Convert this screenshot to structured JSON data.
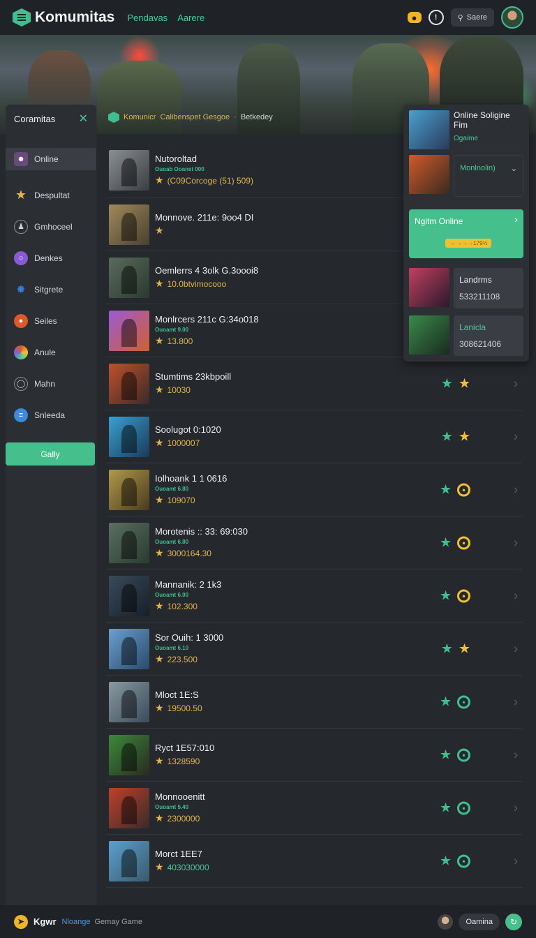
{
  "header": {
    "title": "Komumitas",
    "nav": [
      "Pendavas",
      "Aarere"
    ],
    "search_label": "Saere"
  },
  "hero": {
    "breadcrumb": [
      "Komunicr",
      "Calibenspet Gesgoe",
      "Betkedey"
    ]
  },
  "sidebar": {
    "title": "Coramitas",
    "items": [
      {
        "label": "Online",
        "icon": "avatar-icon",
        "color": "#6a4a7a"
      },
      {
        "label": "Despultat",
        "icon": "star-icon",
        "color": "#e0b54a"
      },
      {
        "label": "Gmhoceel",
        "icon": "people-icon",
        "color": "#8a9096"
      },
      {
        "label": "Denkes",
        "icon": "chat-icon",
        "color": "#8a5ad6"
      },
      {
        "label": "Sitgrete",
        "icon": "burst-icon",
        "color": "#3a7ad6"
      },
      {
        "label": "Seiles",
        "icon": "flame-icon",
        "color": "#e0582a"
      },
      {
        "label": "Anule",
        "icon": "palette-icon",
        "color": "#4ac89a"
      },
      {
        "label": "Mahn",
        "icon": "globe-icon",
        "color": "#6a7076"
      },
      {
        "label": "Snleeda",
        "icon": "layers-icon",
        "color": "#3a8ae0"
      }
    ],
    "button_label": "Gally"
  },
  "list": [
    {
      "title": "Nutoroltad",
      "sub": "Ouoab Ooanst 000",
      "value": "(C09Corcoge (51) 509)",
      "value_color": "yellow",
      "colors": [
        "#8a8f94",
        "#3a3e42"
      ],
      "icons": []
    },
    {
      "title": "Monnove. 211e: 9oo4 DI",
      "sub": "",
      "value": "",
      "value_color": "yellow",
      "colors": [
        "#a08a5a",
        "#4a4030"
      ],
      "icons": []
    },
    {
      "title": "Oemlerrs 4 3olk G.3oooi8",
      "sub": "",
      "value": "10.0btvimocooo",
      "value_color": "yellow",
      "colors": [
        "#5a6a5a",
        "#2a3a30"
      ],
      "icons": []
    },
    {
      "title": "Monlrcers 211c G:34o018",
      "sub": "Ouoamt 9.00",
      "value": "13.800",
      "value_color": "yellow",
      "colors": [
        "#9a5ad6",
        "#d06030"
      ],
      "icons": []
    },
    {
      "title": "Stumtims 23kbpoill",
      "sub": "",
      "value": "10030",
      "value_color": "yellow",
      "colors": [
        "#c0502a",
        "#3a2a2a"
      ],
      "icons": [
        "gstar",
        "ystar"
      ]
    },
    {
      "title": "Soolugot 0:1020",
      "sub": "",
      "value": "1000007",
      "value_color": "yellow",
      "colors": [
        "#3aa0d0",
        "#1a3a5a"
      ],
      "icons": [
        "gstar",
        "ystar"
      ]
    },
    {
      "title": "Iolhoank 1 1 0616",
      "sub": "Ouoamt 6.80",
      "value": "109070",
      "value_color": "yellow",
      "colors": [
        "#b09a4a",
        "#4a3a20"
      ],
      "icons": [
        "gstar",
        "ycirc"
      ]
    },
    {
      "title": "Morotenis :: 33: 69:030",
      "sub": "Ouoamt 6.80",
      "value": "3000164.30",
      "value_color": "yellow",
      "colors": [
        "#5a7060",
        "#2a3a30"
      ],
      "icons": [
        "gstar",
        "ycirc"
      ]
    },
    {
      "title": "Mannanik: 2 1k3",
      "sub": "Ouoamt 6.00",
      "value": "102.300",
      "value_color": "yellow",
      "colors": [
        "#3a4a5a",
        "#15202a"
      ],
      "icons": [
        "gstar",
        "ycirc"
      ]
    },
    {
      "title": "Sor Ouih: 1 3000",
      "sub": "Ouoamt 6.10",
      "value": "223.500",
      "value_color": "yellow",
      "colors": [
        "#6aa0d0",
        "#2a4a6a"
      ],
      "icons": [
        "gstar",
        "ystar"
      ]
    },
    {
      "title": "Mloct 1E:S",
      "sub": "",
      "value": "19500.50",
      "value_color": "yellow",
      "colors": [
        "#8a9aa0",
        "#3a4a5a"
      ],
      "icons": [
        "gstar",
        "gcirc"
      ]
    },
    {
      "title": "Ryct 1E57:010",
      "sub": "",
      "value": "1328590",
      "value_color": "yellow",
      "colors": [
        "#3a8a3a",
        "#2a2a20"
      ],
      "icons": [
        "gstar",
        "gcirc"
      ]
    },
    {
      "title": "Monnooenitt",
      "sub": "Ouoamt 5.40",
      "value": "2300000",
      "value_color": "yellow",
      "colors": [
        "#c0402a",
        "#3a2a2a"
      ],
      "icons": [
        "gstar",
        "gcirc"
      ]
    },
    {
      "title": "Morct 1EE7",
      "sub": "",
      "value": "403030000",
      "value_color": "green",
      "colors": [
        "#5aa0d0",
        "#3a5a6a"
      ],
      "icons": [
        "gstar",
        "gcirc"
      ]
    }
  ],
  "right_panel": {
    "title": "Online Soligine Fim",
    "subtitle": "Ogaime",
    "select_value": "Monlnolin)",
    "online_label": "Ngitm Online",
    "online_badge": "→ →→→179½",
    "stats": [
      {
        "label": "Landrms",
        "value": "533211108",
        "label_color": "white"
      },
      {
        "label": "Lanicla",
        "value": "308621406",
        "label_color": "green"
      }
    ]
  },
  "footer": {
    "brand": "Kgwr",
    "link1": "Nloange",
    "link2": "Gemay Game",
    "user": "Oamina"
  }
}
